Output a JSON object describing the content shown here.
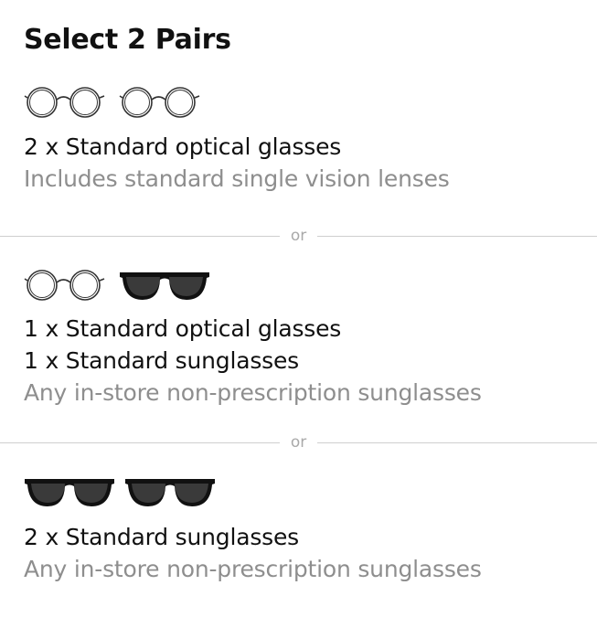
{
  "title": "Select 2 Pairs",
  "options": [
    {
      "icons": [
        "optical-glasses-icon",
        "optical-glasses-icon"
      ],
      "lines": [
        "2 x Standard optical glasses"
      ],
      "description": "Includes standard single vision lenses"
    },
    {
      "icons": [
        "optical-glasses-icon",
        "sunglasses-icon"
      ],
      "lines": [
        "1 x Standard optical glasses",
        "1 x Standard sunglasses"
      ],
      "description": "Any in-store non-prescription sunglasses"
    },
    {
      "icons": [
        "sunglasses-icon",
        "sunglasses-icon"
      ],
      "lines": [
        "2 x Standard sunglasses"
      ],
      "description": "Any in-store non-prescription sunglasses"
    }
  ],
  "divider_label": "or",
  "colors": {
    "text": "#111111",
    "muted": "#8e8e8e",
    "divider": "#cfcfcf",
    "lens_dark": "#2b2b2b"
  }
}
